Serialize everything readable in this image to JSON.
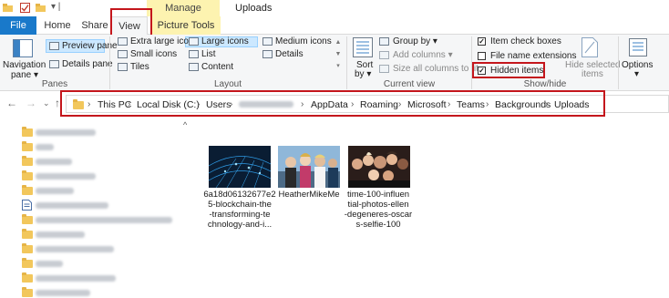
{
  "window": {
    "title": "Uploads",
    "context_tab_group": "Manage"
  },
  "tabs": {
    "file": "File",
    "home": "Home",
    "share": "Share",
    "view": "View",
    "picture_tools": "Picture Tools"
  },
  "ribbon": {
    "panes": {
      "label": "Panes",
      "navigation_pane": "Navigation",
      "navigation_pane_sub": "pane",
      "preview_pane": "Preview pane",
      "details_pane": "Details pane"
    },
    "layout": {
      "label": "Layout",
      "options": [
        "Extra large icons",
        "Large icons",
        "Medium icons",
        "Small icons",
        "List",
        "Details",
        "Tiles",
        "Content"
      ],
      "selected": "Large icons"
    },
    "current_view": {
      "label": "Current view",
      "sort_by": "Sort",
      "sort_by_sub": "by",
      "group_by": "Group by",
      "add_columns": "Add columns",
      "size_all_columns": "Size all columns to fit"
    },
    "show_hide": {
      "label": "Show/hide",
      "item_check_boxes": "Item check boxes",
      "item_check_boxes_checked": true,
      "file_name_extensions": "File name extensions",
      "file_name_extensions_checked": false,
      "hidden_items": "Hidden items",
      "hidden_items_checked": true,
      "hide_selected_items": "Hide selected",
      "hide_selected_items_sub": "items"
    },
    "options": "Options"
  },
  "address_bar": {
    "breadcrumbs": [
      "This PC",
      "Local Disk (C:)",
      "Users",
      "",
      "AppData",
      "Roaming",
      "Microsoft",
      "Teams",
      "Backgrounds",
      "Uploads"
    ]
  },
  "files": [
    {
      "name_lines": [
        "6a18d06132677e2",
        "5-blockchain-the",
        "-transforming-te",
        "chnology-and-i..."
      ],
      "icon": "image-thumbnail-blockchain-network"
    },
    {
      "name_lines": [
        "HeatherMikeMe"
      ],
      "icon": "image-thumbnail-group-photo"
    },
    {
      "name_lines": [
        "time-100-influen",
        "tial-photos-ellen",
        "-degeneres-oscar",
        "s-selfie-100"
      ],
      "icon": "image-thumbnail-oscars-selfie"
    }
  ],
  "colors": {
    "file_tab": "#1979ca",
    "picture_tools_band": "#fdf3b0",
    "highlight_box": "#c4161c",
    "folder": "#f2c75c",
    "selected_layout": "#cce8ff"
  }
}
